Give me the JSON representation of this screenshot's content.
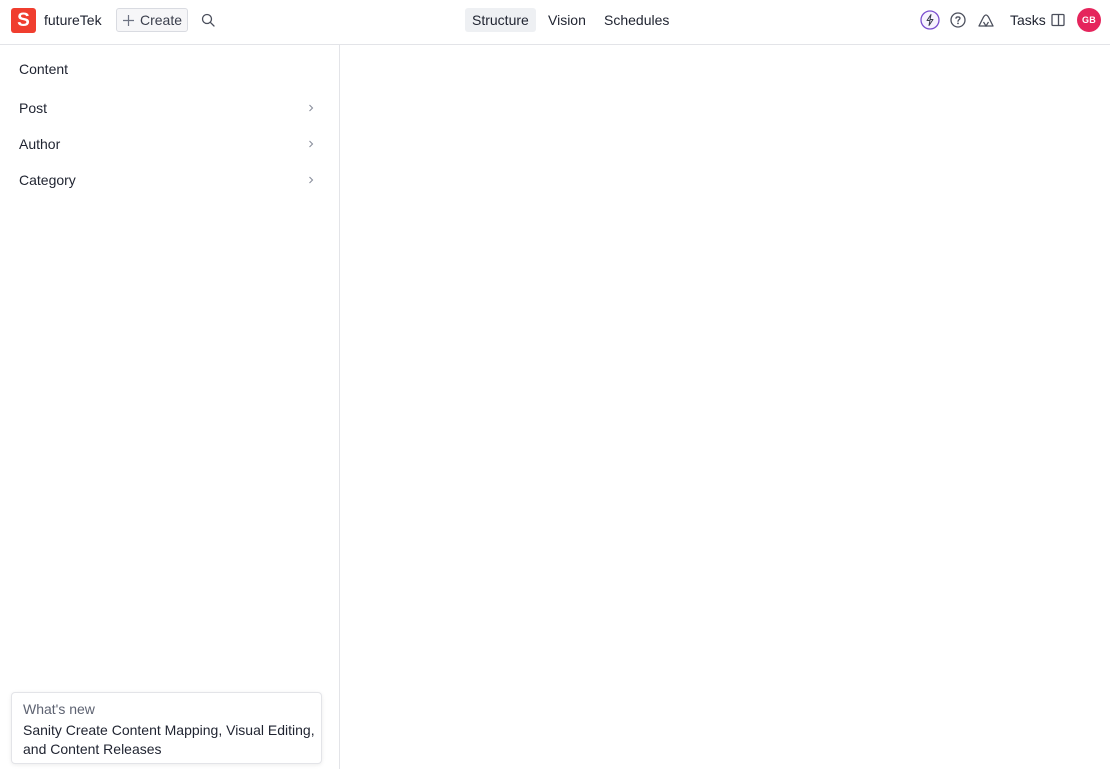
{
  "header": {
    "logo_letter": "S",
    "project_name": "futureTek",
    "create_label": "Create",
    "tabs": [
      {
        "label": "Structure",
        "active": true
      },
      {
        "label": "Vision",
        "active": false
      },
      {
        "label": "Schedules",
        "active": false
      }
    ],
    "tasks_label": "Tasks",
    "avatar_initials": "GB",
    "icons": [
      "search-icon",
      "bolt-icon",
      "help-icon",
      "presence-icon",
      "panel-icon"
    ]
  },
  "sidebar": {
    "title": "Content",
    "items": [
      {
        "label": "Post"
      },
      {
        "label": "Author"
      },
      {
        "label": "Category"
      }
    ]
  },
  "whats_new": {
    "title": "What's new",
    "body": "Sanity Create Content Mapping, Visual Editing, and Content Releases"
  },
  "colors": {
    "brand": "#f03e2f",
    "avatar": "#e5255c",
    "active_tab_bg": "#eef0f3",
    "border": "#e3e4e8",
    "bolt_accent": "#7b4fcf"
  }
}
